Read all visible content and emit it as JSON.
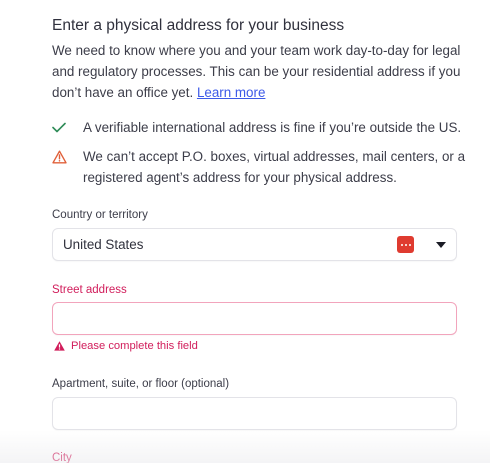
{
  "header": {
    "title": "Enter a physical address for your business",
    "description": "We need to know where you and your team work day-to-day for legal and regulatory processes. This can be your residential address if you don’t have an office yet.",
    "learn_more": "Learn more"
  },
  "notes": [
    {
      "icon": "checkmark-icon",
      "text": "A verifiable international address is fine if you’re outside the US.",
      "color": "#2e8b57"
    },
    {
      "icon": "warning-icon",
      "text": "We can’t accept P.O. boxes, virtual addresses, mail centers, or a registered agent’s address for your physical address.",
      "color": "#e0603a"
    }
  ],
  "form": {
    "country": {
      "label": "Country or territory",
      "value": "United States"
    },
    "street": {
      "label": "Street address",
      "value": "",
      "error": "Please complete this field"
    },
    "apartment": {
      "label": "Apartment, suite, or floor (optional)",
      "value": ""
    },
    "city": {
      "label": "City"
    }
  },
  "colors": {
    "error": "#d11d5b",
    "link": "#3d5ae8",
    "flag": "#df3b30"
  }
}
